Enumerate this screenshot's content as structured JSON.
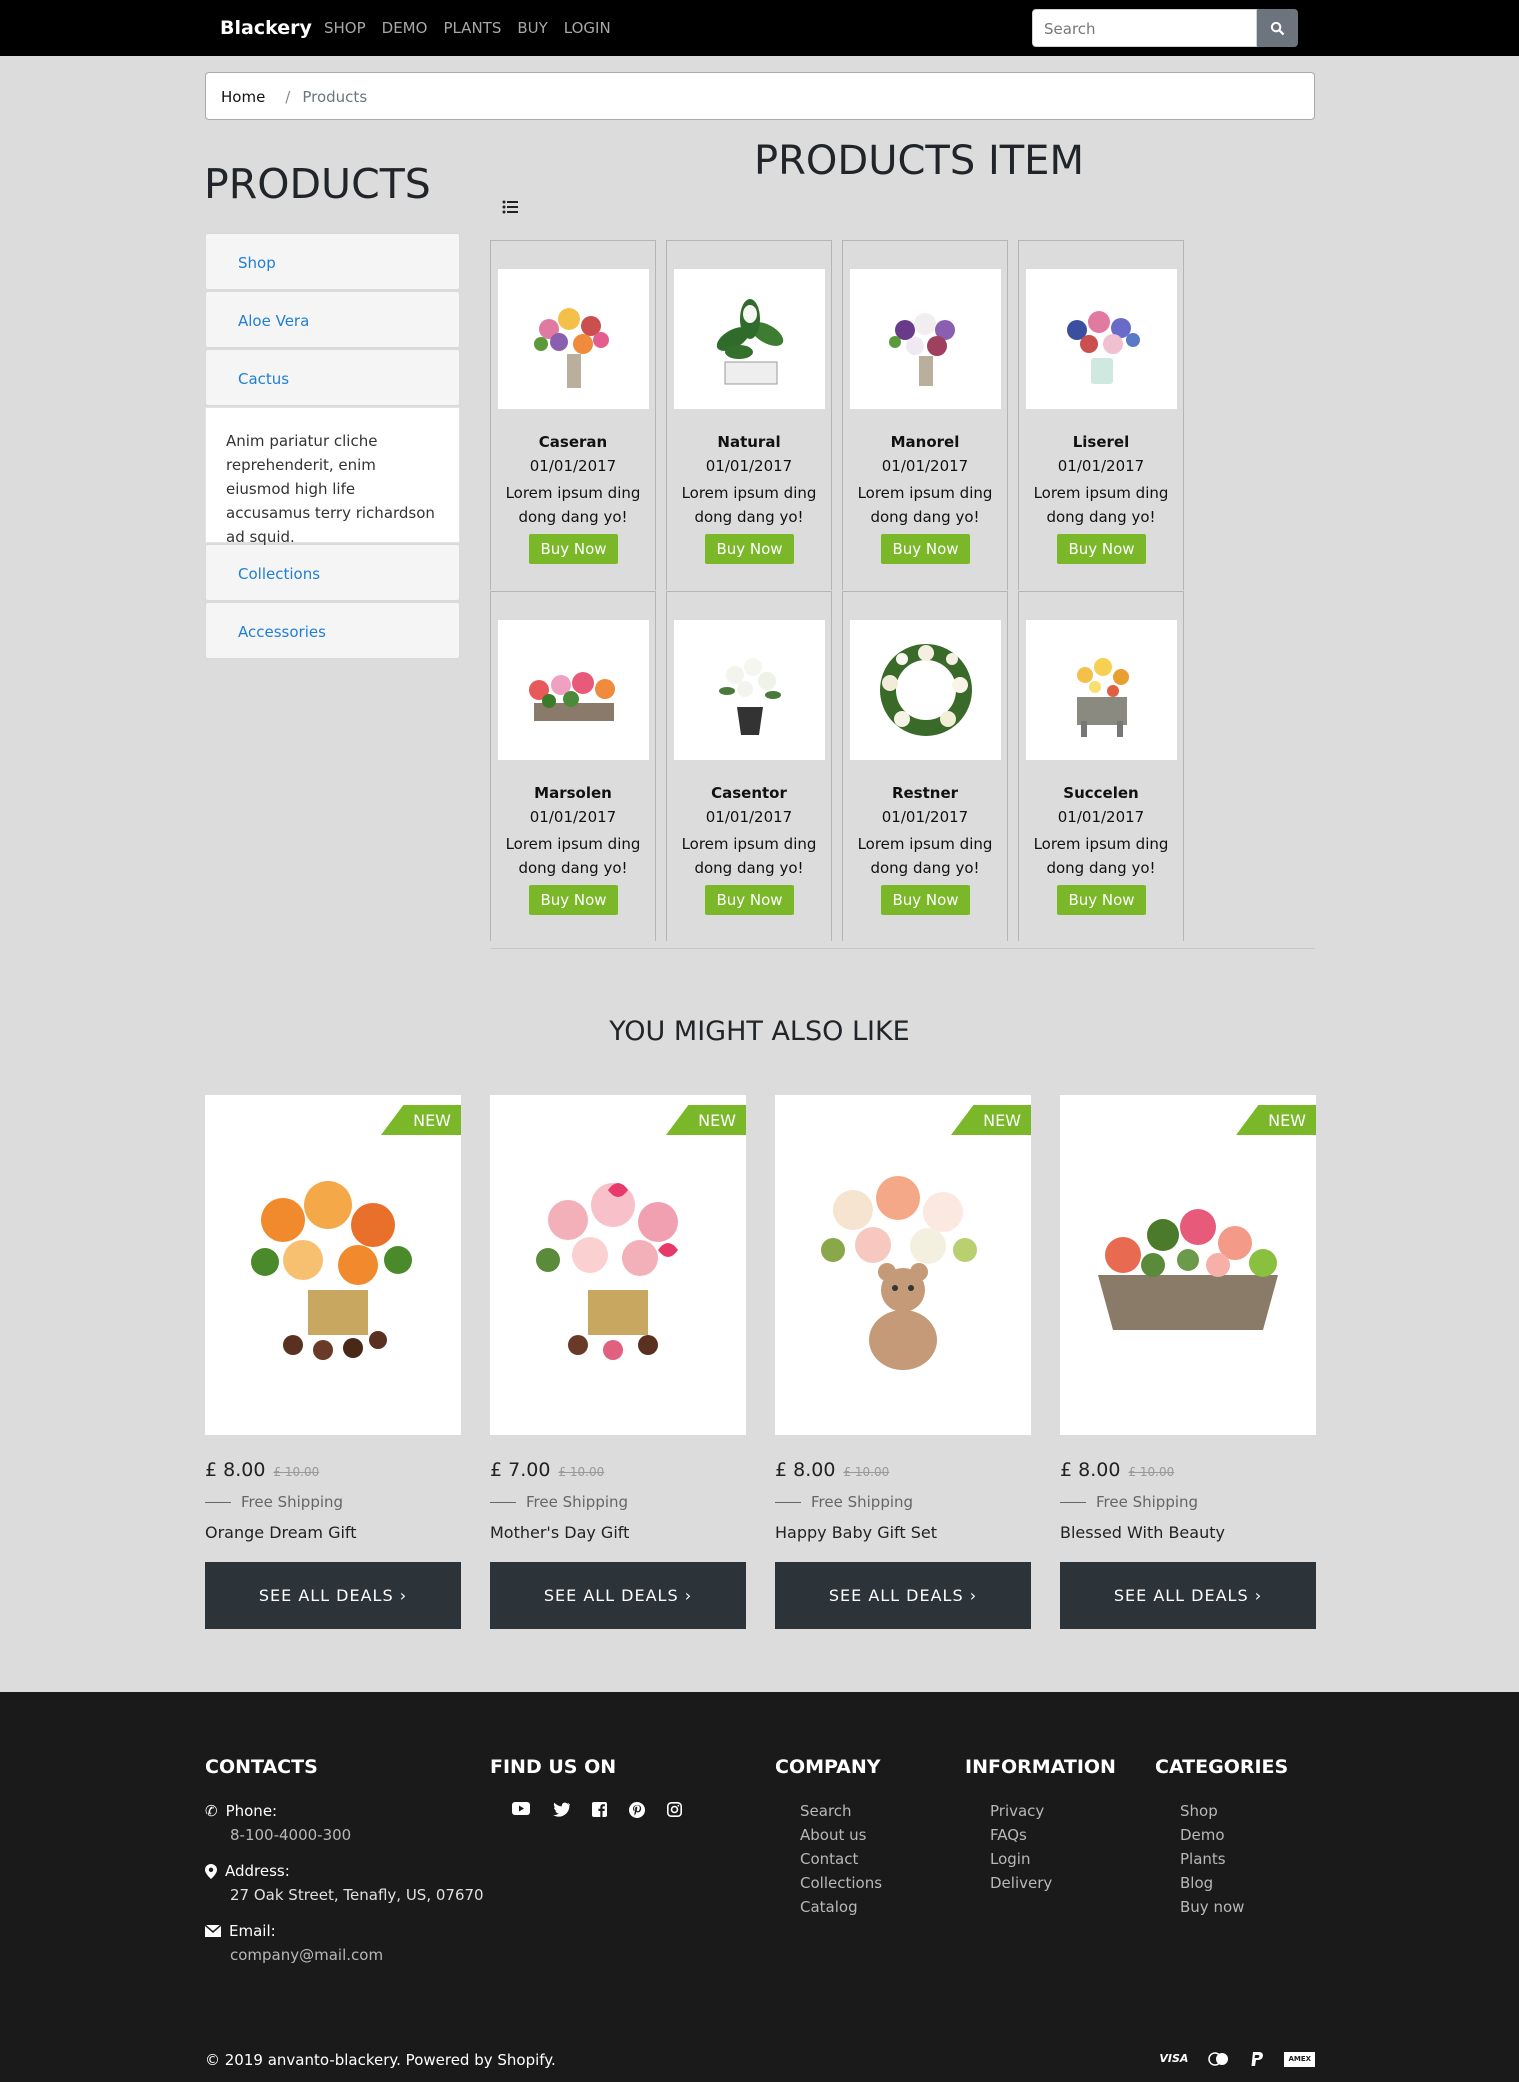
{
  "navbar": {
    "brand": "Blackery",
    "links": [
      "SHOP",
      "DEMO",
      "PLANTS",
      "BUY",
      "LOGIN"
    ],
    "search_placeholder": "Search"
  },
  "breadcrumb": {
    "home": "Home",
    "separator": "/",
    "current": "Products"
  },
  "sidebar": {
    "title": "PRODUCTS",
    "items": [
      "Shop",
      "Aloe Vera",
      "Cactus",
      "Collections",
      "Accessories"
    ],
    "expanded_text": "Anim pariatur cliche reprehenderit, enim eiusmod high life accusamus terry richardson ad squid."
  },
  "products": {
    "title": "PRODUCTS ITEM",
    "items": [
      {
        "name": "Caseran",
        "date": "01/01/2017",
        "desc": "Lorem ipsum ding dong dang yo!",
        "button": "Buy Now"
      },
      {
        "name": "Natural",
        "date": "01/01/2017",
        "desc": "Lorem ipsum ding dong dang yo!",
        "button": "Buy Now"
      },
      {
        "name": "Manorel",
        "date": "01/01/2017",
        "desc": "Lorem ipsum ding dong dang yo!",
        "button": "Buy Now"
      },
      {
        "name": "Liserel",
        "date": "01/01/2017",
        "desc": "Lorem ipsum ding dong dang yo!",
        "button": "Buy Now"
      },
      {
        "name": "Marsolen",
        "date": "01/01/2017",
        "desc": "Lorem ipsum ding dong dang yo!",
        "button": "Buy Now"
      },
      {
        "name": "Casentor",
        "date": "01/01/2017",
        "desc": "Lorem ipsum ding dong dang yo!",
        "button": "Buy Now"
      },
      {
        "name": "Restner",
        "date": "01/01/2017",
        "desc": "Lorem ipsum ding dong dang yo!",
        "button": "Buy Now"
      },
      {
        "name": "Succelen",
        "date": "01/01/2017",
        "desc": "Lorem ipsum ding dong dang yo!",
        "button": "Buy Now"
      }
    ]
  },
  "also_like": {
    "title": "YOU MIGHT ALSO LIKE",
    "items": [
      {
        "tag": "NEW",
        "price": "£ 8.00",
        "old_price": "£ 10.00",
        "shipping": "Free Shipping",
        "name": "Orange Dream Gift",
        "button": "SEE ALL DEALS"
      },
      {
        "tag": "NEW",
        "price": "£ 7.00",
        "old_price": "£ 10.00",
        "shipping": "Free Shipping",
        "name": "Mother's Day Gift",
        "button": "SEE ALL DEALS"
      },
      {
        "tag": "NEW",
        "price": "£ 8.00",
        "old_price": "£ 10.00",
        "shipping": "Free Shipping",
        "name": "Happy Baby Gift Set",
        "button": "SEE ALL DEALS"
      },
      {
        "tag": "NEW",
        "price": "£ 8.00",
        "old_price": "£ 10.00",
        "shipping": "Free Shipping",
        "name": "Blessed With Beauty",
        "button": "SEE ALL DEALS"
      }
    ]
  },
  "footer": {
    "contacts": {
      "title": "CONTACTS",
      "phone_label": "Phone:",
      "phone": "8-100-4000-300",
      "address_label": "Address:",
      "address": "27 Oak Street, Tenafly, US, 07670",
      "email_label": "Email:",
      "email": "company@mail.com"
    },
    "find_us": {
      "title": "FIND US ON",
      "icons": [
        "youtube-icon",
        "twitter-icon",
        "facebook-icon",
        "pinterest-icon",
        "instagram-icon"
      ]
    },
    "company": {
      "title": "COMPANY",
      "links": [
        "Search",
        "About us",
        "Contact",
        "Collections",
        "Catalog"
      ]
    },
    "information": {
      "title": "INFORMATION",
      "links": [
        "Privacy",
        "FAQs",
        "Login",
        "Delivery"
      ]
    },
    "categories": {
      "title": "CATEGORIES",
      "links": [
        "Shop",
        "Demo",
        "Plants",
        "Blog",
        "Buy now"
      ]
    },
    "copyright": "© 2019 anvanto-blackery. Powered by Shopify.",
    "payments": [
      "VISA",
      "mastercard-icon",
      "paypal-icon",
      "AMEX"
    ]
  },
  "colors": {
    "accent": "#7ab829",
    "link": "#1f7fd4",
    "dark_button": "#2c3339",
    "footer_bg": "#1a1a1a"
  }
}
